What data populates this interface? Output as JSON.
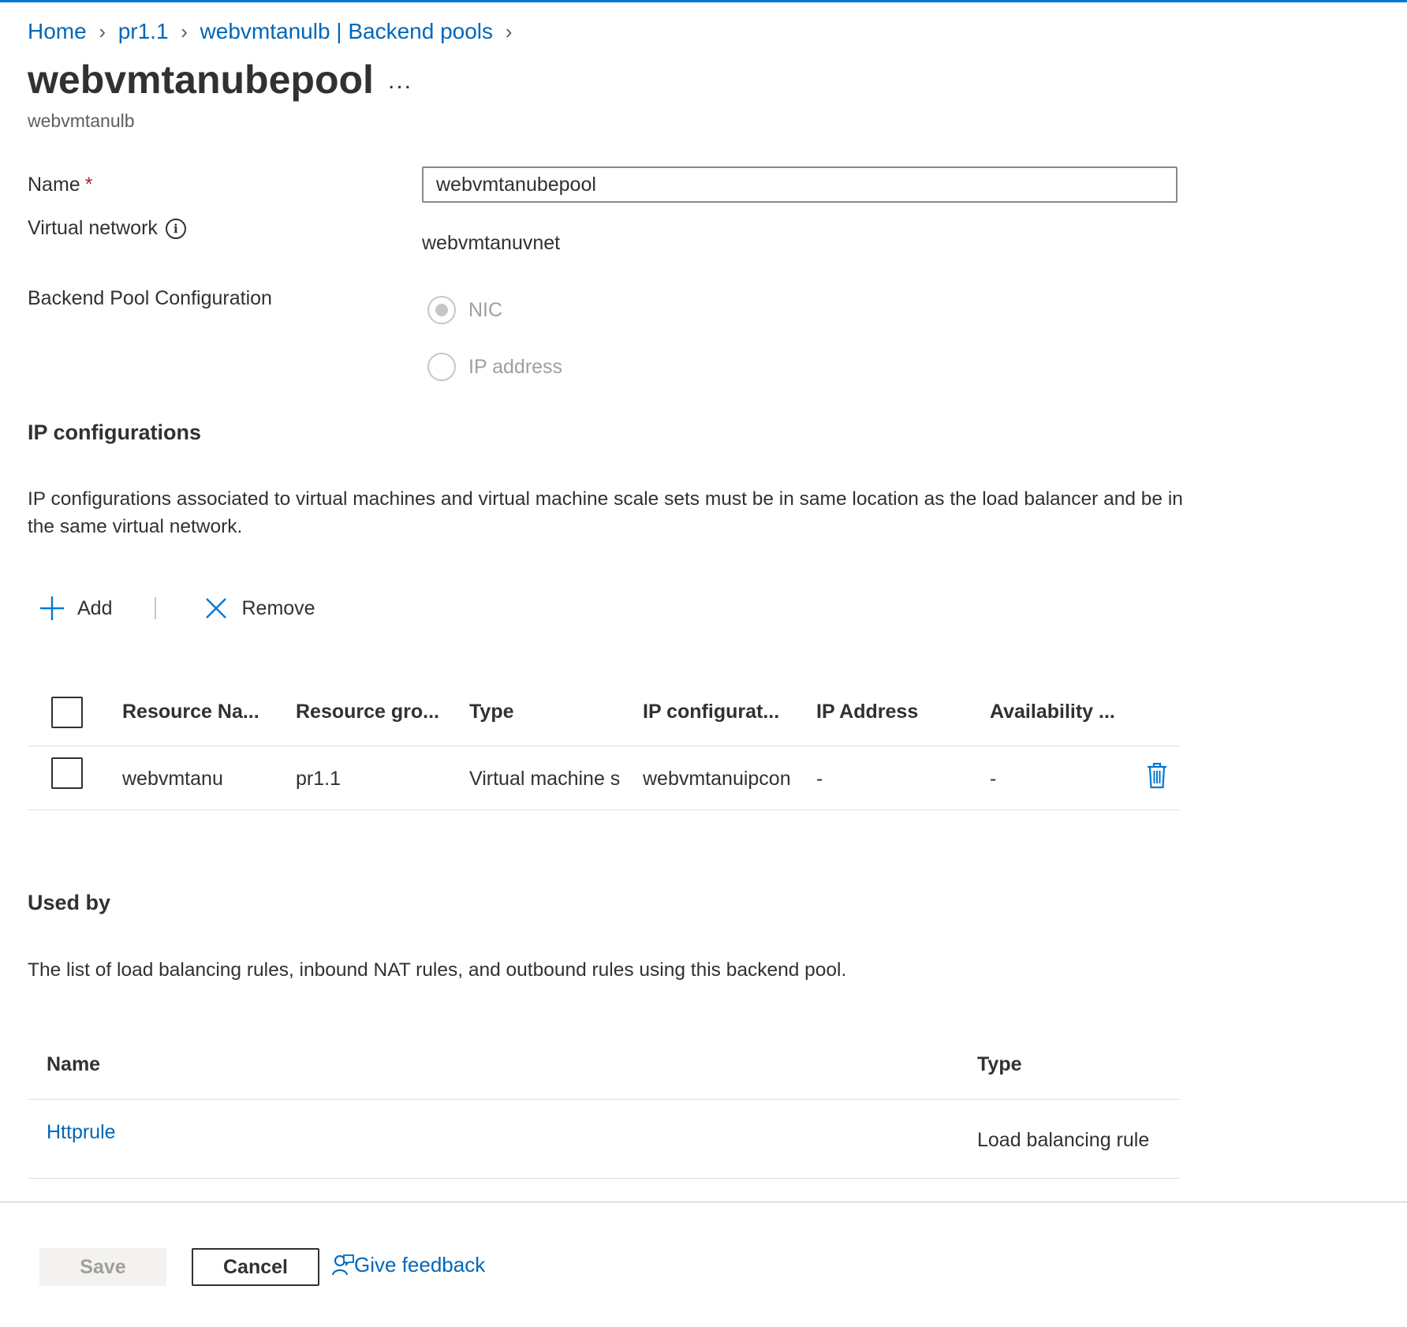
{
  "breadcrumb": {
    "items": [
      "Home",
      "pr1.1",
      "webvmtanulb | Backend pools"
    ]
  },
  "header": {
    "title": "webvmtanubepool",
    "more_label": "...",
    "subtitle": "webvmtanulb"
  },
  "form": {
    "name_label": "Name",
    "required_marker": "*",
    "name_value": "webvmtanubepool",
    "vnet_label": "Virtual network",
    "vnet_value": "webvmtanuvnet",
    "backend_config_label": "Backend Pool Configuration",
    "options": [
      {
        "label": "NIC",
        "selected": true,
        "disabled": true
      },
      {
        "label": "IP address",
        "selected": false,
        "disabled": true
      }
    ]
  },
  "ip_configs": {
    "title": "IP configurations",
    "description": "IP configurations associated to virtual machines and virtual machine scale sets must be in same location as the load balancer and be in the same virtual network.",
    "toolbar": {
      "add_label": "Add",
      "remove_label": "Remove"
    },
    "columns": [
      "Resource Na...",
      "Resource gro...",
      "Type",
      "IP configurat...",
      "IP Address",
      "Availability ..."
    ],
    "rows": [
      {
        "resource_name": "webvmtanu",
        "resource_group": "pr1.1",
        "type": "Virtual machine s",
        "ip_configuration": "webvmtanuipcon",
        "ip_address": "-",
        "availability": "-"
      }
    ]
  },
  "used_by": {
    "title": "Used by",
    "description": "The list of load balancing rules, inbound NAT rules, and outbound rules using this backend pool.",
    "columns": [
      "Name",
      "Type"
    ],
    "rows": [
      {
        "name": "Httprule",
        "type": "Load balancing rule"
      }
    ]
  },
  "footer": {
    "save_label": "Save",
    "cancel_label": "Cancel",
    "feedback_label": "Give feedback"
  },
  "colors": {
    "accent": "#0078d4",
    "link": "#0067b8",
    "required": "#a4262c"
  }
}
